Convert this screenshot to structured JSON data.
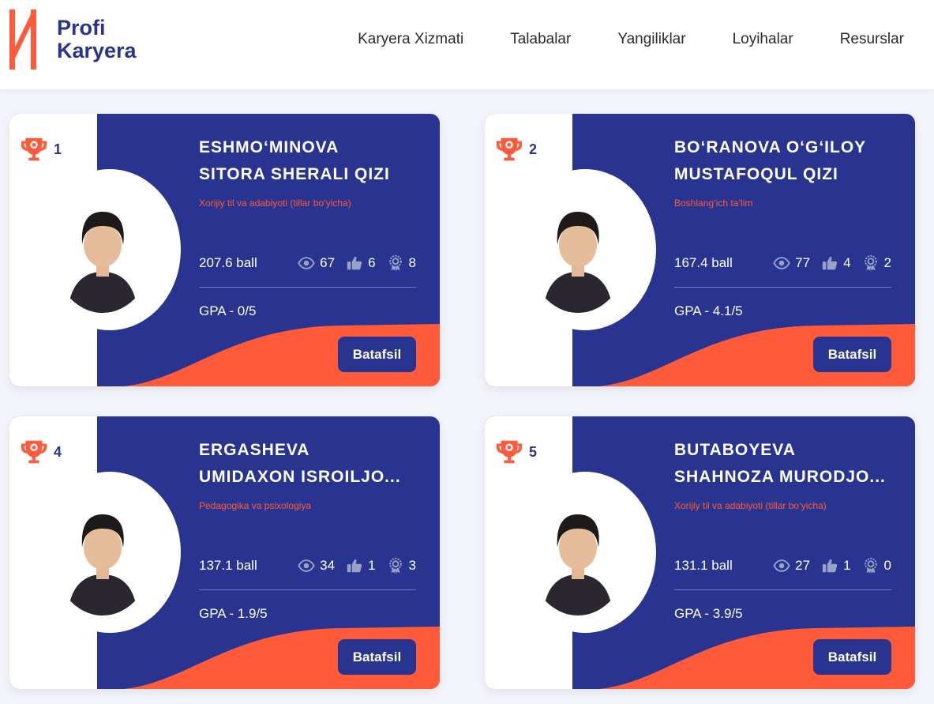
{
  "brand": {
    "name_line1": "Profi",
    "name_line2": "Karyera",
    "primary_color": "#28348f",
    "accent_color": "#ff5a3a"
  },
  "nav": [
    {
      "label": "Karyera Xizmati"
    },
    {
      "label": "Talabalar"
    },
    {
      "label": "Yangiliklar"
    },
    {
      "label": "Loyihalar"
    },
    {
      "label": "Resurslar"
    }
  ],
  "cards": [
    {
      "rank": "1",
      "name_line1": "ESHMO‘MINOVA",
      "name_line2": "SITORA SHERALI QIZI",
      "major": "Xorijiy til va adabiyoti (tillar bo‘yicha)",
      "ball": "207.6 ball",
      "views": "67",
      "likes": "6",
      "awards": "8",
      "gpa": "GPA - 0/5",
      "button": "Batafsil"
    },
    {
      "rank": "2",
      "name_line1": "BO‘RANOVA O‘G‘ILOY",
      "name_line2": "MUSTAFOQUL QIZI",
      "major": "Boshlang‘ich ta’lim",
      "ball": "167.4 ball",
      "views": "77",
      "likes": "4",
      "awards": "2",
      "gpa": "GPA - 4.1/5",
      "button": "Batafsil"
    },
    {
      "rank": "4",
      "name_line1": "ERGASHEVA",
      "name_line2": "UMIDAXON ISROILJO...",
      "major": "Pedagogika va psixologiya",
      "ball": "137.1 ball",
      "views": "34",
      "likes": "1",
      "awards": "3",
      "gpa": "GPA - 1.9/5",
      "button": "Batafsil"
    },
    {
      "rank": "5",
      "name_line1": "BUTABOYEVA",
      "name_line2": "SHAHNOZA MURODJO...",
      "major": "Xorijiy til va adabiyoti (tillar bo‘yicha)",
      "ball": "131.1 ball",
      "views": "27",
      "likes": "1",
      "awards": "0",
      "gpa": "GPA - 3.9/5",
      "button": "Batafsil"
    }
  ]
}
